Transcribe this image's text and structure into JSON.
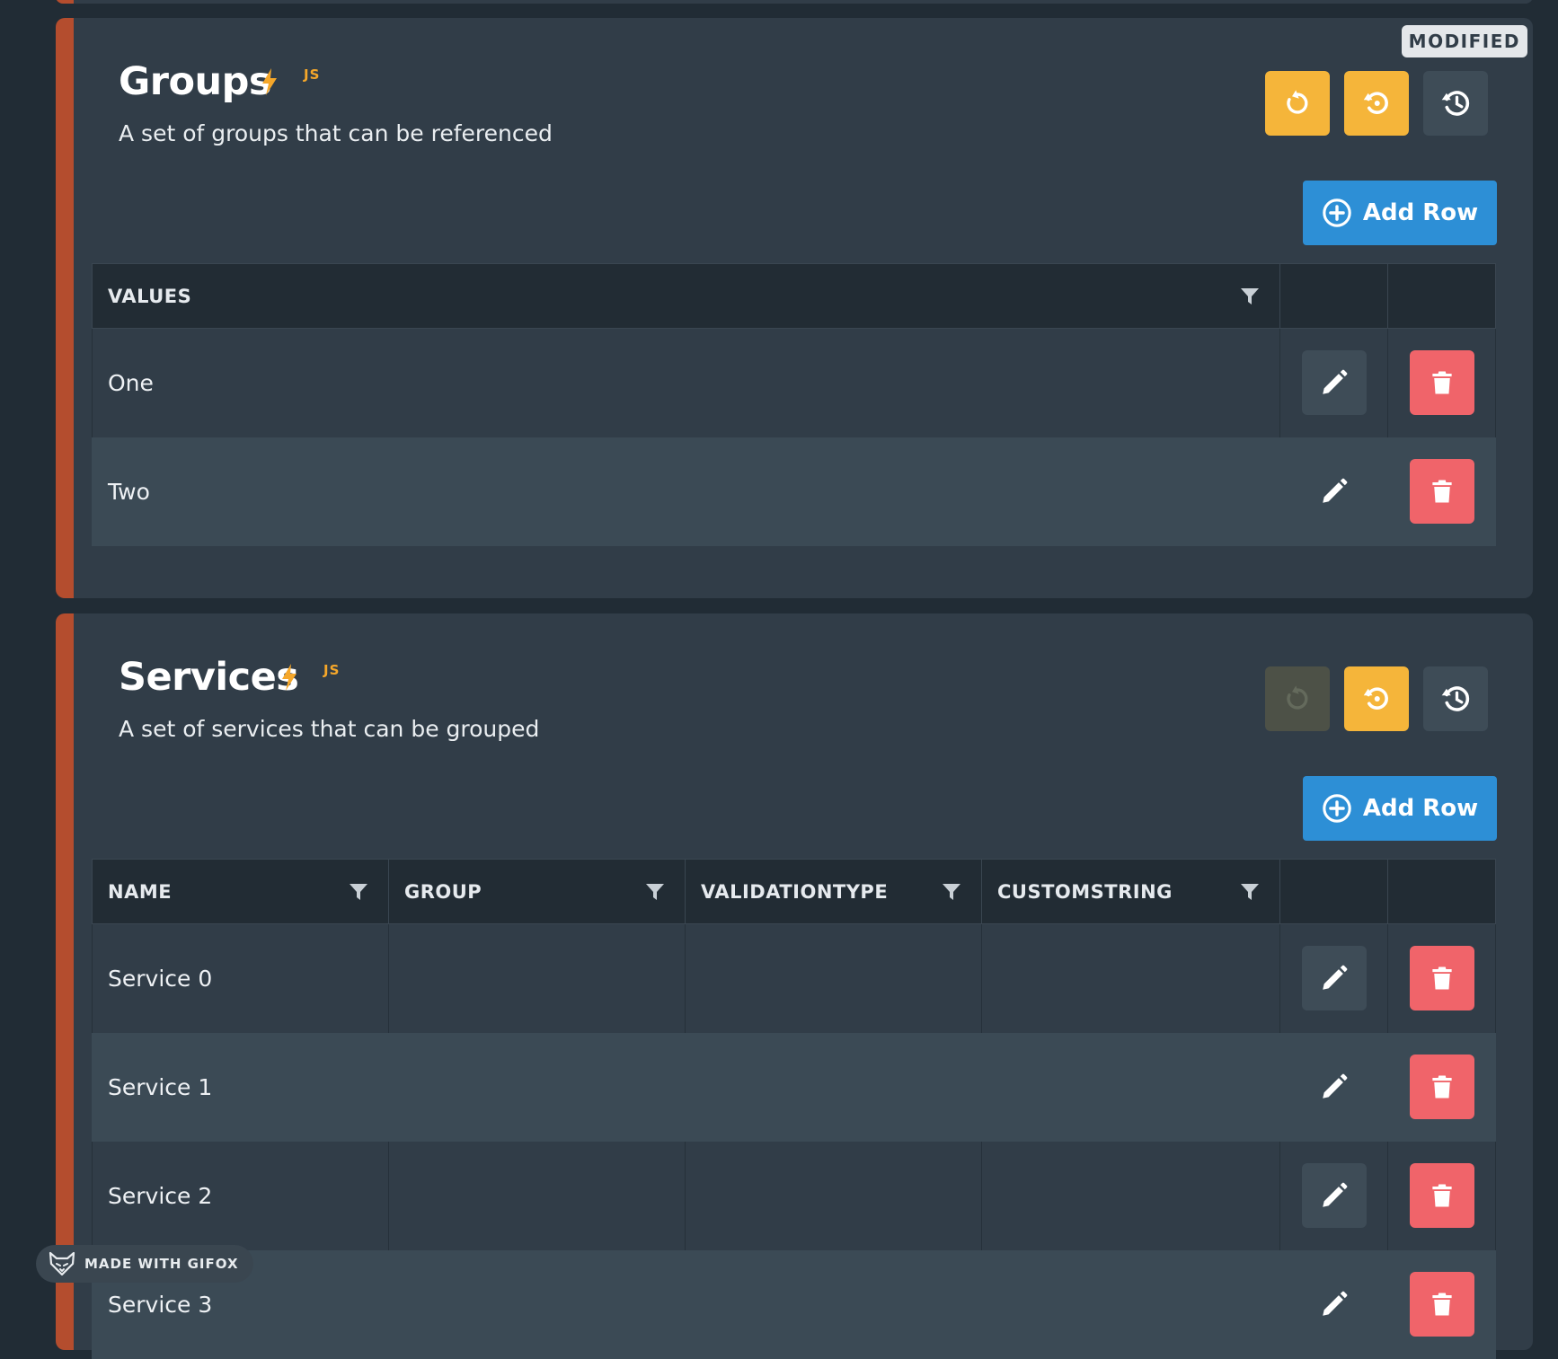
{
  "groups": {
    "title": "Groups",
    "js_badge": "JS",
    "description": "A set of groups that can be referenced",
    "modified_badge": "MODIFIED",
    "add_row_label": "Add Row",
    "columns": [
      "VALUES"
    ],
    "rows": [
      {
        "values": "One"
      },
      {
        "values": "Two"
      }
    ]
  },
  "services": {
    "title": "Services",
    "js_badge": "JS",
    "description": "A set of services that can be grouped",
    "add_row_label": "Add Row",
    "columns": [
      "NAME",
      "GROUP",
      "VALIDATIONTYPE",
      "CUSTOMSTRING"
    ],
    "rows": [
      {
        "name": "Service 0",
        "group": "",
        "validationtype": "",
        "customstring": ""
      },
      {
        "name": "Service 1",
        "group": "",
        "validationtype": "",
        "customstring": ""
      },
      {
        "name": "Service 2",
        "group": "",
        "validationtype": "",
        "customstring": ""
      },
      {
        "name": "Service 3",
        "group": "",
        "validationtype": "",
        "customstring": ""
      }
    ]
  },
  "watermark": {
    "label": "MADE WITH GIFOX"
  },
  "colors": {
    "accent_bar": "#b44d2e",
    "warning": "#f5b53a",
    "primary": "#2d8fd6",
    "danger": "#f0646a",
    "card_bg": "#313d48",
    "page_bg": "#212c35"
  }
}
